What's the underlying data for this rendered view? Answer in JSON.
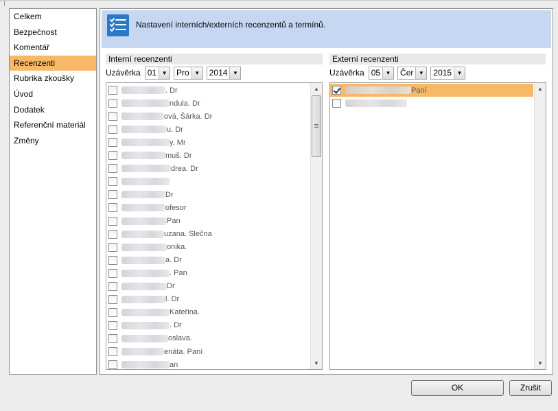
{
  "nav": {
    "items": [
      {
        "label": "Celkem",
        "active": false
      },
      {
        "label": "Bezpečnost",
        "active": false
      },
      {
        "label": "Komentář",
        "active": false
      },
      {
        "label": "Recenzenti",
        "active": true
      },
      {
        "label": "Rubrika zkoušky",
        "active": false
      },
      {
        "label": "Úvod",
        "active": false
      },
      {
        "label": "Dodatek",
        "active": false
      },
      {
        "label": "Referenční materiál",
        "active": false
      },
      {
        "label": "Změny",
        "active": false
      }
    ]
  },
  "header": {
    "icon": "checklist-icon",
    "title": "Nastavení interních/externích recenzentů a termínů."
  },
  "internal": {
    "section_title": "Interní recenzenti",
    "deadline_label": "Uzávěrka",
    "day": "01",
    "month": "Pro",
    "year": "2014",
    "reviewers": [
      {
        "text": ". Dr",
        "checked": false
      },
      {
        "text": "ndula. Dr",
        "checked": false
      },
      {
        "text": "ová, Šárka. Dr",
        "checked": false
      },
      {
        "text": "u. Dr",
        "checked": false
      },
      {
        "text": "y. Mr",
        "checked": false
      },
      {
        "text": "muš. Dr",
        "checked": false
      },
      {
        "text": "drea. Dr",
        "checked": false
      },
      {
        "text": "",
        "checked": false
      },
      {
        "text": "Dr",
        "checked": false
      },
      {
        "text": "ofesor",
        "checked": false
      },
      {
        "text": "Pan",
        "checked": false
      },
      {
        "text": "uzana. Slečna",
        "checked": false
      },
      {
        "text": "onika.",
        "checked": false
      },
      {
        "text": "a. Dr",
        "checked": false
      },
      {
        "text": ". Pan",
        "checked": false
      },
      {
        "text": "Dr",
        "checked": false
      },
      {
        "text": "l. Dr",
        "checked": false
      },
      {
        "text": "Kateřina.",
        "checked": false
      },
      {
        "text": ". Dr",
        "checked": false
      },
      {
        "text": "oslava.",
        "checked": false
      },
      {
        "text": "enáta. Paní",
        "checked": false
      },
      {
        "text": "an",
        "checked": false
      }
    ]
  },
  "external": {
    "section_title": "Externí recenzenti",
    "deadline_label": "Uzávěrka",
    "day": "05",
    "month": "Čer",
    "year": "2015",
    "reviewers": [
      {
        "text": "Paní",
        "checked": true,
        "selected": true
      },
      {
        "text": "",
        "checked": false,
        "selected": false
      }
    ]
  },
  "buttons": {
    "ok": "OK",
    "cancel": "Zrušit"
  },
  "colors": {
    "selection": "#f9b868",
    "header_bg": "#c6d8f1",
    "icon_bg": "#2b78c5"
  }
}
